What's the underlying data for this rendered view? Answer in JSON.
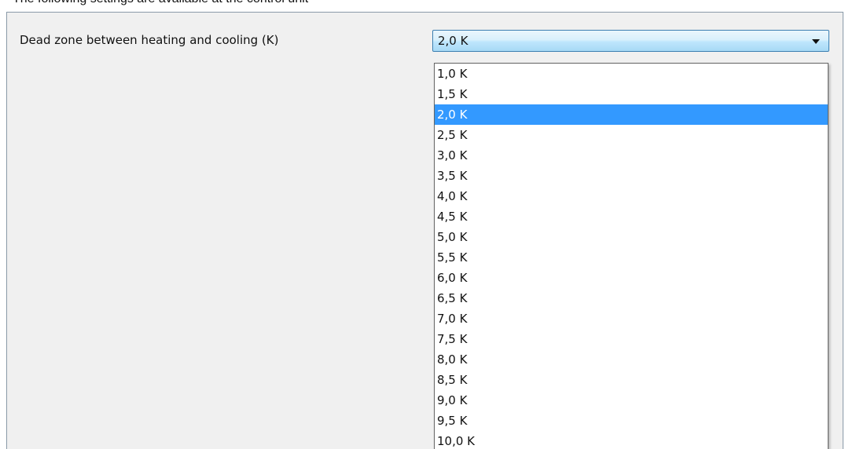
{
  "caption": "The following settings are available at the control unit",
  "panel": {
    "label": "Dead zone between heating and cooling (K)",
    "select": {
      "value": "2,0 K",
      "selected_index": 2,
      "options": [
        "1,0 K",
        "1,5 K",
        "2,0 K",
        "2,5 K",
        "3,0 K",
        "3,5 K",
        "4,0 K",
        "4,5 K",
        "5,0 K",
        "5,5 K",
        "6,0 K",
        "6,5 K",
        "7,0 K",
        "7,5 K",
        "8,0 K",
        "8,5 K",
        "9,0 K",
        "9,5 K",
        "10,0 K"
      ],
      "arrow_icon": "chevron-down-icon"
    }
  },
  "colors": {
    "selection": "#3399ff",
    "combo_border": "#3c7fb1",
    "panel_background": "#f0f0f0"
  }
}
